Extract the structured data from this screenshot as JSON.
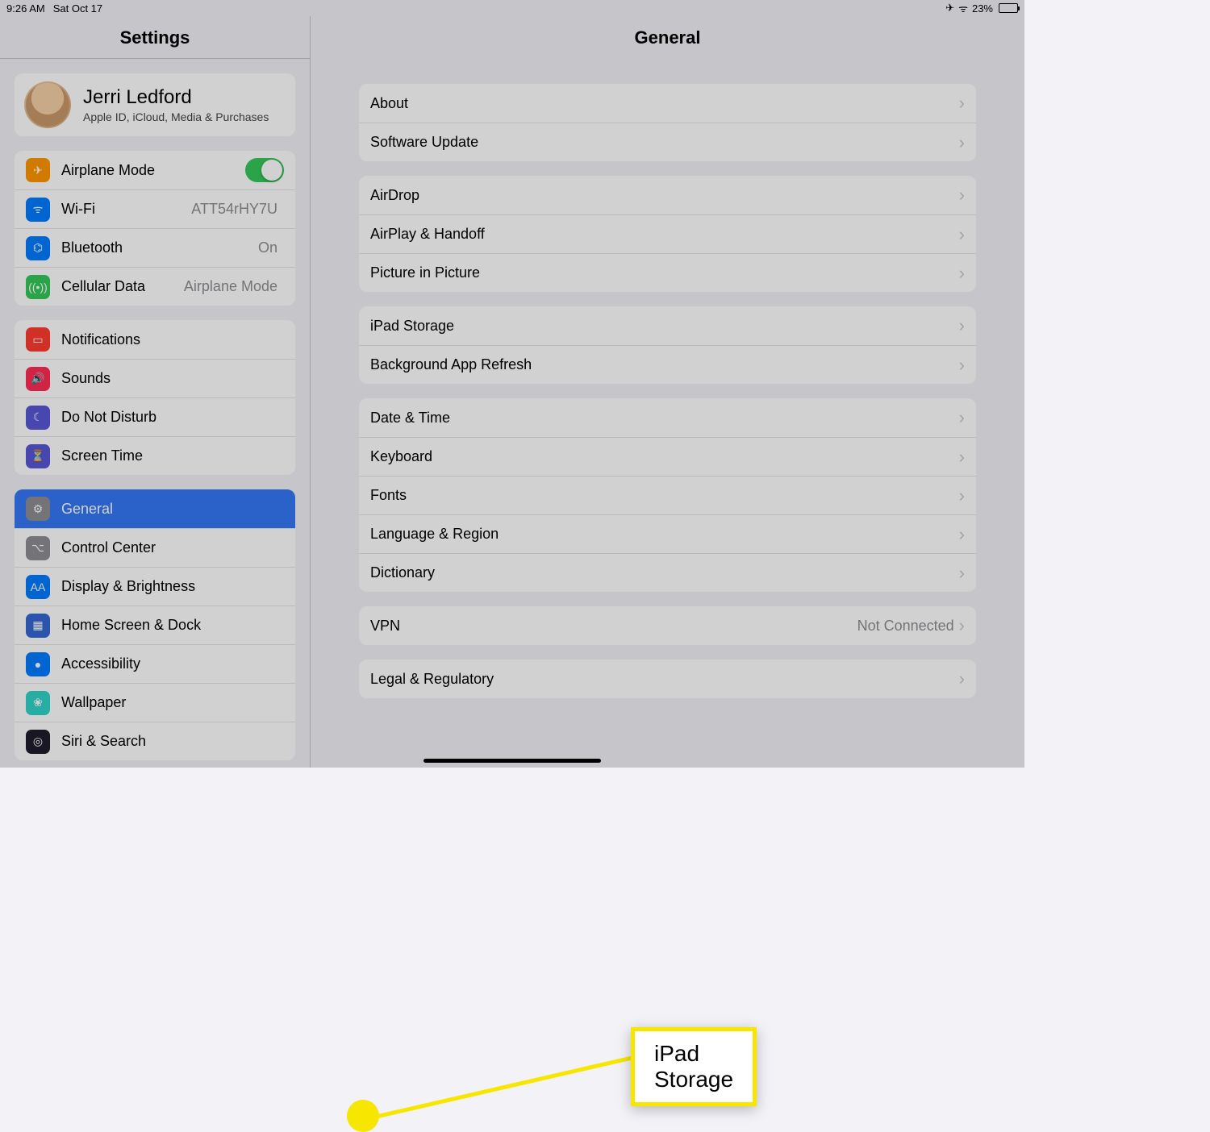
{
  "status": {
    "time": "9:26 AM",
    "date": "Sat Oct 17",
    "battery_pct": "23%"
  },
  "sidebar": {
    "title": "Settings",
    "profile": {
      "name": "Jerri Ledford",
      "sub": "Apple ID, iCloud, Media & Purchases"
    },
    "group_connectivity": [
      {
        "label": "Airplane Mode",
        "type": "toggle",
        "icon": "airplane"
      },
      {
        "label": "Wi-Fi",
        "value": "ATT54rHY7U",
        "icon": "wifi"
      },
      {
        "label": "Bluetooth",
        "value": "On",
        "icon": "bt"
      },
      {
        "label": "Cellular Data",
        "value": "Airplane Mode",
        "icon": "cell"
      }
    ],
    "group_notifications": [
      {
        "label": "Notifications",
        "icon": "notif"
      },
      {
        "label": "Sounds",
        "icon": "sound"
      },
      {
        "label": "Do Not Disturb",
        "icon": "dnd"
      },
      {
        "label": "Screen Time",
        "icon": "st"
      }
    ],
    "group_general": [
      {
        "label": "General",
        "icon": "general",
        "selected": true
      },
      {
        "label": "Control Center",
        "icon": "cc"
      },
      {
        "label": "Display & Brightness",
        "icon": "db"
      },
      {
        "label": "Home Screen & Dock",
        "icon": "hs"
      },
      {
        "label": "Accessibility",
        "icon": "acc"
      },
      {
        "label": "Wallpaper",
        "icon": "wall"
      },
      {
        "label": "Siri & Search",
        "icon": "siri"
      }
    ]
  },
  "detail": {
    "title": "General",
    "groups": [
      [
        {
          "label": "About"
        },
        {
          "label": "Software Update"
        }
      ],
      [
        {
          "label": "AirDrop"
        },
        {
          "label": "AirPlay & Handoff"
        },
        {
          "label": "Picture in Picture"
        }
      ],
      [
        {
          "label": "iPad Storage"
        },
        {
          "label": "Background App Refresh"
        }
      ],
      [
        {
          "label": "Date & Time"
        },
        {
          "label": "Keyboard"
        },
        {
          "label": "Fonts"
        },
        {
          "label": "Language & Region"
        },
        {
          "label": "Dictionary"
        }
      ],
      [
        {
          "label": "VPN",
          "value": "Not Connected"
        }
      ],
      [
        {
          "label": "Legal & Regulatory"
        }
      ]
    ]
  },
  "annotation": {
    "callout_label": "iPad Storage"
  },
  "icons": {
    "airplane": "✈︎",
    "wifi": "ᯤ",
    "bt": "⌬",
    "cell": "((•))",
    "notif": "▭",
    "sound": "🔊",
    "dnd": "☾",
    "st": "⏳",
    "general": "⚙",
    "cc": "⌥",
    "db": "AA",
    "hs": "▦",
    "acc": "●",
    "wall": "❀",
    "siri": "◎"
  }
}
